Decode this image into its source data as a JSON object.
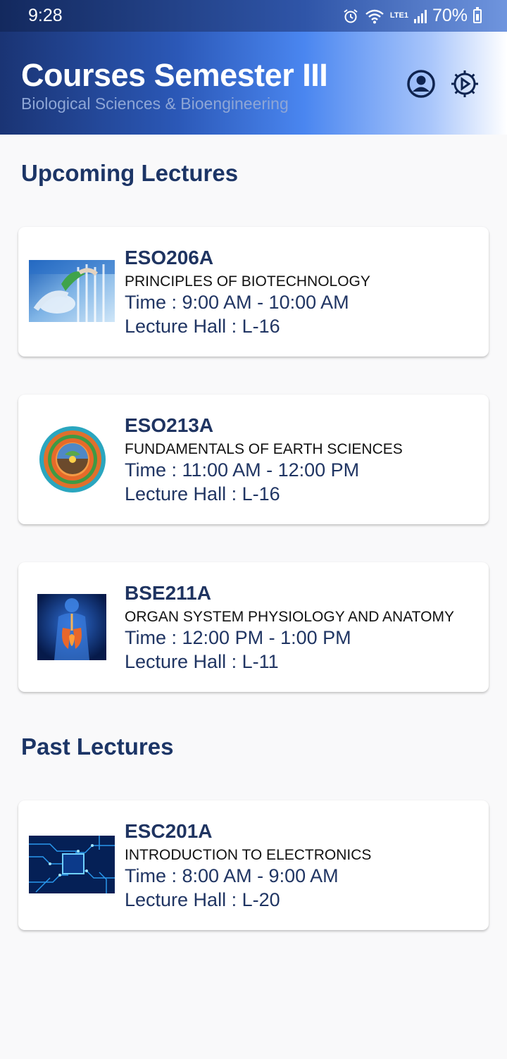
{
  "status": {
    "time": "9:28",
    "battery": "70%",
    "network": "LTE1"
  },
  "header": {
    "title": "Courses Semester III",
    "subtitle": "Biological Sciences & Bioengineering",
    "icons": [
      "profile-icon",
      "settings-icon"
    ]
  },
  "sections": {
    "upcoming": "Upcoming Lectures",
    "past": "Past Lectures"
  },
  "upcoming": [
    {
      "code": "ESO206A",
      "name": "PRINCIPLES OF BIOTECHNOLOGY",
      "time": "Time : 9:00 AM - 10:00 AM",
      "hall": "Lecture Hall : L-16",
      "image": "biotechnology-image"
    },
    {
      "code": "ESO213A",
      "name": "FUNDAMENTALS OF EARTH SCIENCES",
      "time": "Time : 11:00 AM - 12:00 PM",
      "hall": "Lecture Hall : L-16",
      "image": "earth-layers-image"
    },
    {
      "code": "BSE211A",
      "name": "ORGAN SYSTEM PHYSIOLOGY AND ANATOMY",
      "time": "Time : 12:00 PM - 1:00 PM",
      "hall": "Lecture Hall : L-11",
      "image": "anatomy-image"
    }
  ],
  "past": [
    {
      "code": "ESC201A",
      "name": "INTRODUCTION TO ELECTRONICS",
      "time": "Time : 8:00 AM - 9:00 AM",
      "hall": "Lecture Hall : L-20",
      "image": "circuit-board-image"
    }
  ],
  "colors": {
    "primary": "#1f3461",
    "header_start": "#1a3474",
    "header_mid": "#4a86f0",
    "background": "#f9f9fa"
  }
}
